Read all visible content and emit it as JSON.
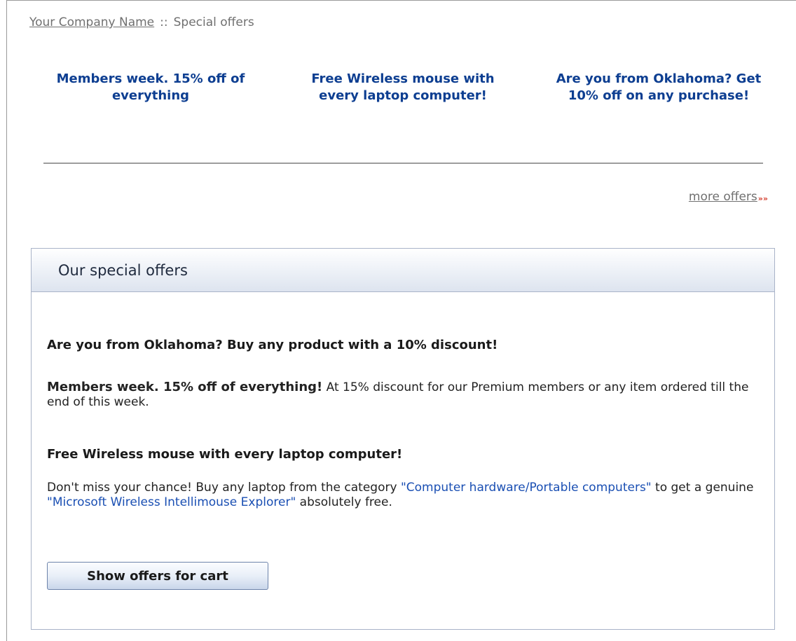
{
  "breadcrumb": {
    "company": "Your Company Name",
    "separator": "::",
    "current": "Special offers"
  },
  "promos": [
    {
      "text": "Members week. 15% off of everything"
    },
    {
      "text": "Free Wireless mouse with every laptop computer!"
    },
    {
      "text": "Are you from Oklahoma? Get 10% off on any purchase!"
    }
  ],
  "more_offers": {
    "label": "more offers",
    "arrows": "»»"
  },
  "panel": {
    "title": "Our special offers",
    "offer1_heading": "Are you from Oklahoma? Buy any product with a 10% discount!",
    "offer2_bold": "Members week. 15% off of everything!",
    "offer2_text": " At 15% discount for our Premium members or any item ordered till the end of this week.",
    "offer3_heading": "Free Wireless mouse with every laptop computer!",
    "offer3_text_a": "Don't miss your chance! Buy any laptop from the category ",
    "offer3_link_category": "\"Computer hardware/Portable computers\"",
    "offer3_text_b": " to get a genuine ",
    "offer3_link_product": "\"Microsoft Wireless Intellimouse Explorer\"",
    "offer3_text_c": " absolutely free.",
    "button_label": "Show offers for cart"
  },
  "colors": {
    "promo_link": "#0d3e91",
    "body_link": "#1a4fb3",
    "arrow_accent": "#d33c2c"
  }
}
